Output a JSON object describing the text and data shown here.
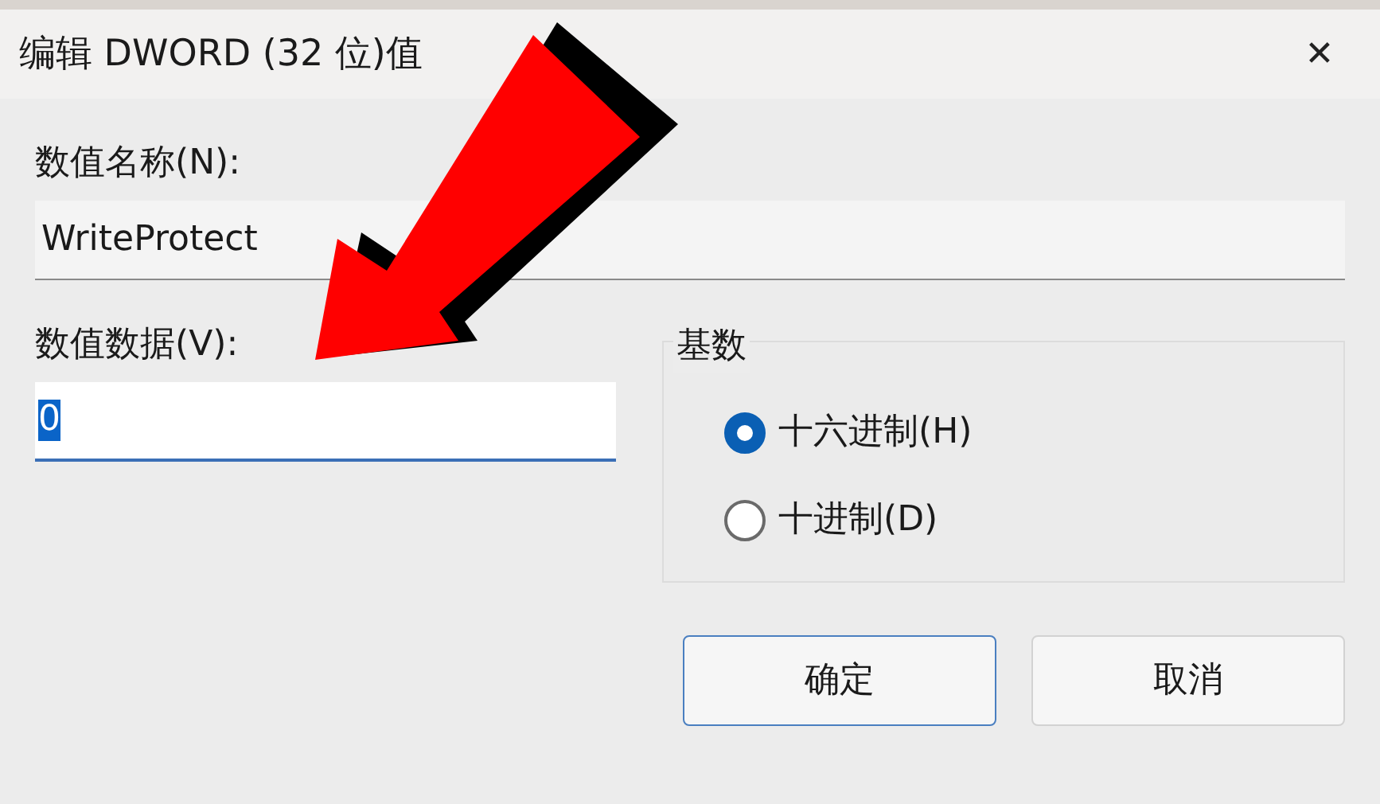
{
  "window": {
    "title": "编辑 DWORD (32 位)值",
    "close": "✕"
  },
  "name_field": {
    "label": "数值名称(N):",
    "value": "WriteProtect"
  },
  "data_field": {
    "label": "数值数据(V):",
    "value": "0",
    "text_selected": true
  },
  "base_group": {
    "label": "基数",
    "options": [
      {
        "label": "十六进制(H)",
        "selected": true
      },
      {
        "label": "十进制(D)",
        "selected": false
      }
    ]
  },
  "buttons": [
    {
      "label": "确定",
      "default": true
    },
    {
      "label": "取消",
      "default": false
    }
  ],
  "annotation": {
    "kind": "arrow"
  }
}
